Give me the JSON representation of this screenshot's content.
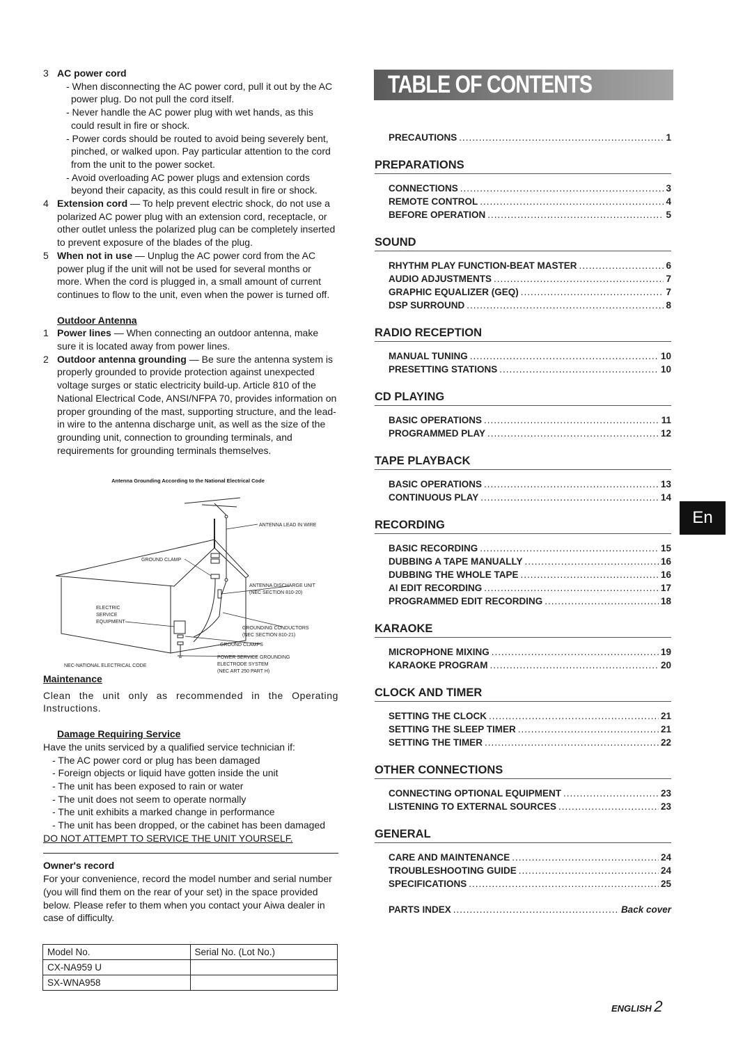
{
  "left": {
    "ac_cord": {
      "num": "3",
      "title": "AC power cord",
      "bullets": [
        "When disconnecting the AC power cord, pull it out by the AC power plug. Do not pull the cord itself.",
        "Never handle the AC power plug with wet hands, as this could result in fire or shock.",
        "Power cords should be routed to avoid being severely bent, pinched, or walked upon. Pay particular attention to the cord from the unit to the power socket.",
        "Avoid overloading AC power plugs and extension cords beyond their capacity, as this could result in fire or shock."
      ]
    },
    "ext_cord": {
      "num": "4",
      "title": "Extension cord",
      "text": " — To help prevent electric shock, do not use a polarized AC power plug with an extension cord, receptacle, or other outlet unless the polarized plug can be completely inserted to prevent exposure of the blades of the plug."
    },
    "not_in_use": {
      "num": "5",
      "title": "When not in use",
      "text": " — Unplug the AC power cord from the AC power plug if the unit will not be used for several months or more. When the cord is plugged in, a small amount of current continues to flow to the unit, even when the power is turned off."
    },
    "outdoor_antenna": {
      "heading": "Outdoor Antenna",
      "items": [
        {
          "num": "1",
          "title": "Power lines",
          "text": " — When connecting an outdoor antenna, make sure it is located away from power lines."
        },
        {
          "num": "2",
          "title": "Outdoor antenna grounding",
          "text": " — Be sure the antenna system is properly grounded to provide protection against unexpected voltage surges or static electricity build-up. Article 810 of the National Electrical Code, ANSI/NFPA 70, provides information on proper grounding of the mast, supporting structure, and the lead-in wire to the antenna discharge unit, as well as the size of the grounding unit, connection to grounding terminals, and requirements for grounding terminals themselves."
        }
      ]
    },
    "diagram": {
      "caption": "Antenna Grounding According to the National Electrical Code",
      "antenna_lead": "ANTENNA LEAD IN WIRE",
      "ground_clamp": "GROUND CLAMP",
      "discharge_unit": "ANTENNA DISCHARGE UNIT",
      "discharge_section": "(NEC SECTION 810-20)",
      "electric": "ELECTRIC",
      "service": "SERVICE",
      "equipment": "EQUIPMENT",
      "conductors": "GROUNDING CONDUCTORS",
      "conductors_section": "(NEC SECTION 810-21)",
      "ground_clamps": "GROUND CLAMPS",
      "power_service": "POWER SERVICE GROUNDING",
      "electrode": "ELECTRODE SYSTEM",
      "nec_art": "(NEC ART 250 PART H)",
      "nec": "NEC-NATIONAL ELECTRICAL CODE"
    },
    "maintenance": {
      "heading": "Maintenance",
      "text": "Clean the unit only as recommended in the Operating Instructions."
    },
    "damage": {
      "heading": "Damage Requiring Service",
      "intro": "Have the units serviced by a qualified service technician if:",
      "bullets": [
        "The AC power cord or plug has been damaged",
        "Foreign objects or liquid have gotten inside the unit",
        "The unit has been exposed to rain or water",
        "The unit does not seem to operate normally",
        "The unit exhibits a marked change in performance",
        "The unit has been dropped, or the cabinet has been damaged"
      ],
      "warning": "DO NOT ATTEMPT TO SERVICE THE UNIT YOURSELF."
    },
    "owners_record": {
      "heading": "Owner's record",
      "text": "For your convenience, record the model number and serial number (you will find them on the rear of your set) in the space provided below. Please refer to them when you contact your Aiwa dealer in case of difficulty.",
      "table": {
        "headers": [
          "Model No.",
          "Serial No. (Lot No.)"
        ],
        "rows": [
          [
            "CX-NA959 U",
            ""
          ],
          [
            "SX-WNA958",
            ""
          ]
        ]
      }
    }
  },
  "toc": {
    "title": "TABLE OF CONTENTS",
    "precautions": {
      "label": "PRECAUTIONS",
      "page": "1"
    },
    "sections": [
      {
        "title": "PREPARATIONS",
        "entries": [
          {
            "label": "CONNECTIONS",
            "page": "3"
          },
          {
            "label": "REMOTE CONTROL",
            "page": "4"
          },
          {
            "label": "BEFORE OPERATION",
            "page": "5"
          }
        ]
      },
      {
        "title": "SOUND",
        "entries": [
          {
            "label": "RHYTHM PLAY FUNCTION-BEAT MASTER",
            "page": "6"
          },
          {
            "label": "AUDIO ADJUSTMENTS",
            "page": "7"
          },
          {
            "label": "GRAPHIC EQUALIZER (GEQ)",
            "page": "7"
          },
          {
            "label": "DSP SURROUND",
            "page": "8"
          }
        ]
      },
      {
        "title": "RADIO RECEPTION",
        "entries": [
          {
            "label": "MANUAL TUNING",
            "page": "10"
          },
          {
            "label": "PRESETTING STATIONS",
            "page": "10"
          }
        ]
      },
      {
        "title": "CD PLAYING",
        "entries": [
          {
            "label": "BASIC OPERATIONS",
            "page": "11"
          },
          {
            "label": "PROGRAMMED PLAY",
            "page": "12"
          }
        ]
      },
      {
        "title": "TAPE PLAYBACK",
        "entries": [
          {
            "label": "BASIC OPERATIONS",
            "page": "13"
          },
          {
            "label": "CONTINUOUS PLAY",
            "page": "14"
          }
        ]
      },
      {
        "title": "RECORDING",
        "entries": [
          {
            "label": "BASIC RECORDING",
            "page": "15"
          },
          {
            "label": "DUBBING A TAPE MANUALLY",
            "page": "16"
          },
          {
            "label": "DUBBING THE WHOLE TAPE",
            "page": "16"
          },
          {
            "label": "AI EDIT RECORDING",
            "page": "17"
          },
          {
            "label": "PROGRAMMED EDIT RECORDING",
            "page": "18"
          }
        ]
      },
      {
        "title": "KARAOKE",
        "entries": [
          {
            "label": "MICROPHONE MIXING",
            "page": "19"
          },
          {
            "label": "KARAOKE PROGRAM",
            "page": "20"
          }
        ]
      },
      {
        "title": "CLOCK AND TIMER",
        "entries": [
          {
            "label": "SETTING THE CLOCK",
            "page": "21"
          },
          {
            "label": "SETTING THE SLEEP TIMER",
            "page": "21"
          },
          {
            "label": "SETTING THE TIMER",
            "page": "22"
          }
        ]
      },
      {
        "title": "OTHER CONNECTIONS",
        "entries": [
          {
            "label": "CONNECTING OPTIONAL EQUIPMENT",
            "page": "23"
          },
          {
            "label": "LISTENING TO EXTERNAL SOURCES",
            "page": "23"
          }
        ]
      },
      {
        "title": "GENERAL",
        "entries": [
          {
            "label": "CARE AND MAINTENANCE",
            "page": "24"
          },
          {
            "label": "TROUBLESHOOTING GUIDE",
            "page": "24"
          },
          {
            "label": "SPECIFICATIONS",
            "page": "25"
          }
        ]
      }
    ],
    "parts_index": {
      "label": "PARTS INDEX",
      "page": "Back cover"
    }
  },
  "tab": "En",
  "footer": {
    "language": "ENGLISH",
    "page": "2"
  }
}
